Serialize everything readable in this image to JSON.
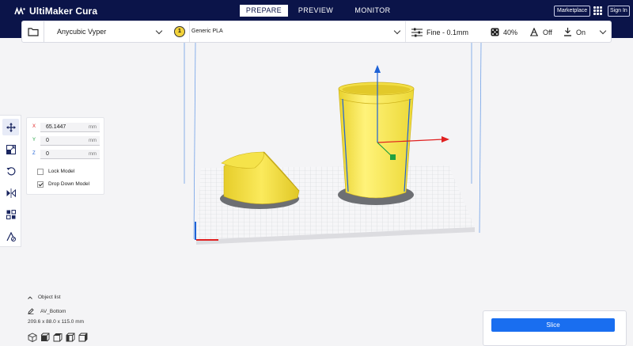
{
  "app": {
    "title": "UltiMaker Cura"
  },
  "header": {
    "tabs": [
      "PREPARE",
      "PREVIEW",
      "MONITOR"
    ],
    "marketplace_label": "Marketplace",
    "signin_label": "Sign In"
  },
  "stagebar": {
    "printer": "Anycubic Vyper",
    "material_extruder_number": "1",
    "material": "Generic PLA",
    "profile": "Fine - 0.1mm",
    "infill": "40%",
    "support": "Off",
    "adhesion": "On"
  },
  "move_panel": {
    "x_label": "X",
    "x_value": "65.1447",
    "y_label": "Y",
    "y_value": "0",
    "z_label": "Z",
    "z_value": "0",
    "unit": "mm",
    "lock_model_label": "Lock Model",
    "lock_model_checked": false,
    "drop_down_label": "Drop Down Model",
    "drop_down_checked": true
  },
  "object_list": {
    "toggle_label": "Object list",
    "object_name": "AV_Bottom",
    "dimensions": "209.6 x 88.0 x 115.0 mm"
  },
  "slice": {
    "button_label": "Slice"
  },
  "colors": {
    "header_bg": "#0b1449",
    "accent_blue": "#196ef0",
    "model_yellow": "#f7e44a",
    "axis_red": "#e02020",
    "axis_green": "#20a040",
    "axis_blue": "#1e62d6"
  }
}
